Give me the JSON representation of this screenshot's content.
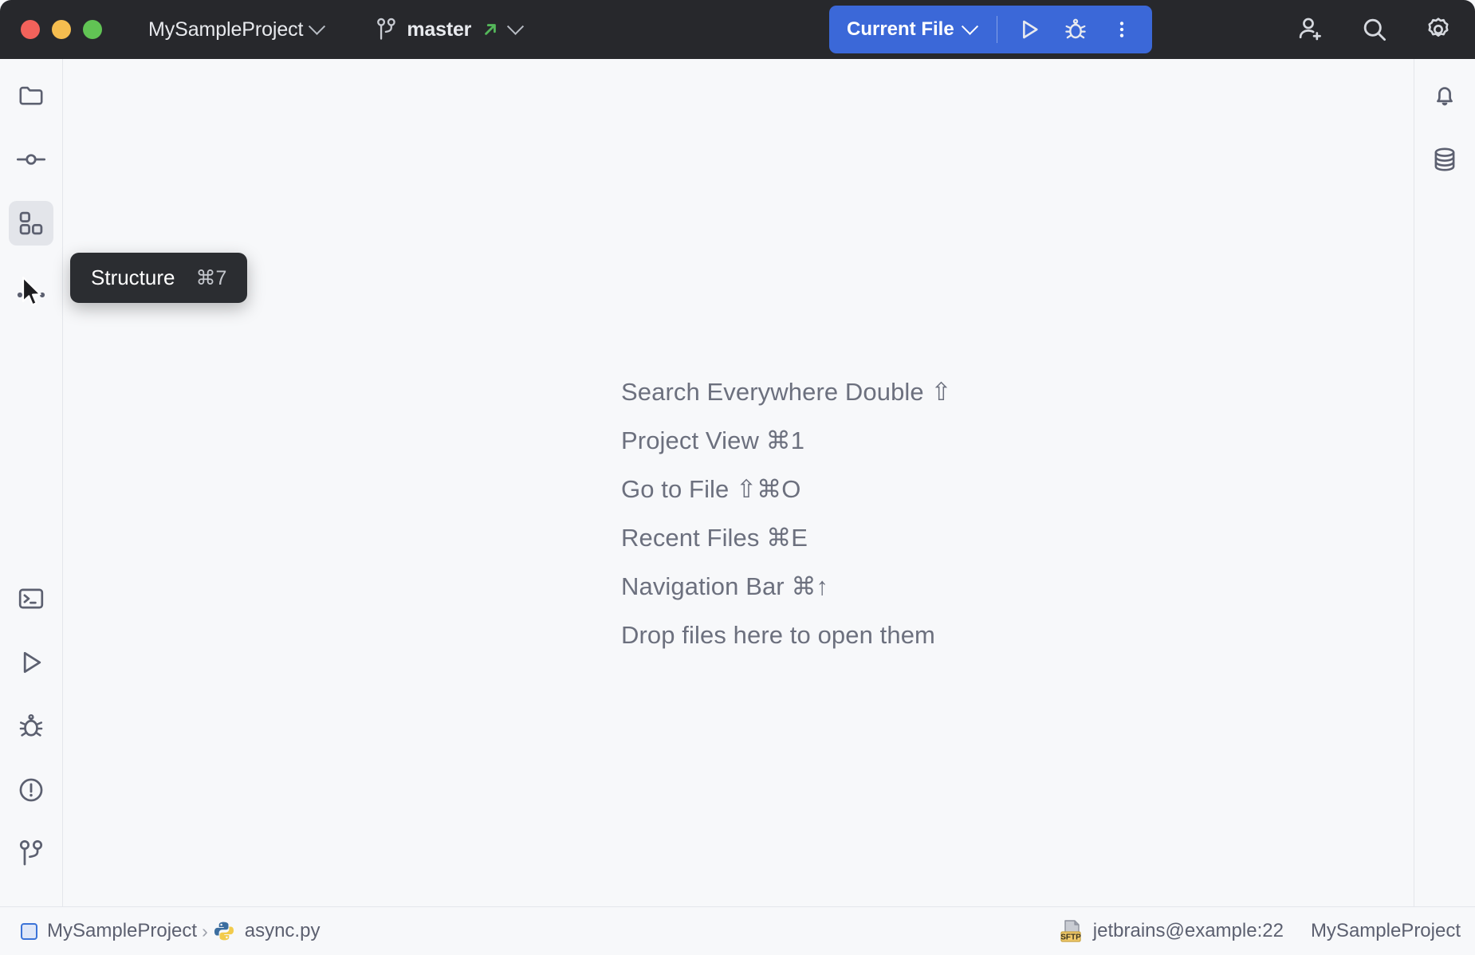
{
  "window": {
    "traffic_lights": [
      {
        "name": "close",
        "color": "#f2625b"
      },
      {
        "name": "minimize",
        "color": "#f5bd4f"
      },
      {
        "name": "maximize",
        "color": "#61c454"
      }
    ],
    "project_name": "MySampleProject",
    "branch_name": "master",
    "titlebar_bg": "#27282c"
  },
  "run_widget": {
    "config_label": "Current File",
    "accent_color": "#3b68d8",
    "buttons": [
      {
        "name": "run-button",
        "icon": "play-icon"
      },
      {
        "name": "debug-button",
        "icon": "bug-icon"
      },
      {
        "name": "more-button",
        "icon": "kebab-menu-icon"
      }
    ]
  },
  "titlebar_actions": [
    {
      "name": "add-user-button",
      "icon": "add-user-icon"
    },
    {
      "name": "search-button",
      "icon": "search-icon"
    },
    {
      "name": "settings-button",
      "icon": "gear-icon"
    }
  ],
  "left_stripe": {
    "top_items": [
      {
        "name": "project-tool-window",
        "icon": "folder-icon",
        "label": "Project",
        "active": false
      },
      {
        "name": "commit-tool-window",
        "icon": "commit-icon",
        "label": "Commit",
        "active": false
      },
      {
        "name": "structure-tool-window",
        "icon": "structure-icon",
        "label": "Structure",
        "active": true
      },
      {
        "name": "more-tool-windows",
        "icon": "ellipsis-icon",
        "label": "More Tool Windows",
        "active": false
      }
    ],
    "bottom_items": [
      {
        "name": "terminal-tool-window",
        "icon": "terminal-icon",
        "label": "Terminal"
      },
      {
        "name": "run-tool-window",
        "icon": "play-icon",
        "label": "Run"
      },
      {
        "name": "debug-tool-window",
        "icon": "bug-icon",
        "label": "Debug"
      },
      {
        "name": "problems-tool-window",
        "icon": "warning-circle-icon",
        "label": "Problems"
      },
      {
        "name": "version-control-tool-window",
        "icon": "git-branch-icon",
        "label": "Version Control"
      }
    ]
  },
  "right_stripe": {
    "items": [
      {
        "name": "notifications-tool-window",
        "icon": "bell-icon",
        "label": "Notifications"
      },
      {
        "name": "database-tool-window",
        "icon": "database-icon",
        "label": "Database"
      }
    ]
  },
  "tooltip": {
    "label": "Structure",
    "shortcut": "⌘7"
  },
  "editor_hints": [
    "Search Everywhere Double ⇧",
    "Project View ⌘1",
    "Go to File ⇧⌘O",
    "Recent Files ⌘E",
    "Navigation Bar ⌘↑",
    "Drop files here to open them"
  ],
  "statusbar": {
    "breadcrumb": [
      {
        "name": "breadcrumb-module",
        "label": "MySampleProject",
        "icon": "module-icon"
      },
      {
        "name": "breadcrumb-file",
        "label": "async.py",
        "icon": "python-file-icon"
      }
    ],
    "breadcrumb_separator": "›",
    "remote_interpreter": "jetbrains@example:22",
    "remote_badge": "SFTP",
    "project_label": "MySampleProject"
  }
}
